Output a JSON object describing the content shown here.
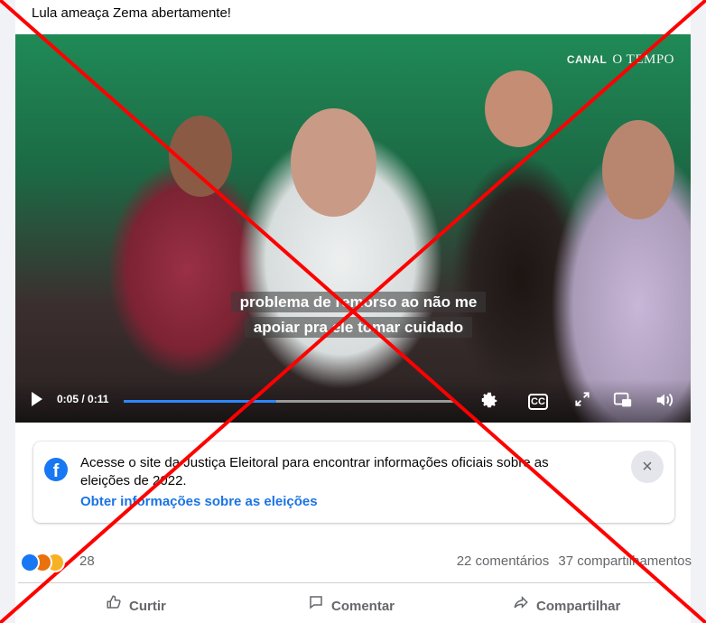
{
  "post": {
    "text": "Lula ameaça Zema abertamente!"
  },
  "video": {
    "watermark_prefix": "CANAL",
    "watermark_name": "O TEMPO",
    "subtitle_line1": "problema de remorso ao não me",
    "subtitle_line2": "apoiar pra ele tomar cuidado",
    "time": "0:05 / 0:11",
    "progress": 0.46,
    "icons": {
      "play": "play-icon",
      "settings": "gear-icon",
      "captions": "captions-icon",
      "expand": "expand-icon",
      "pip": "picture-in-picture-icon",
      "volume": "volume-icon"
    },
    "cc_label": "CC"
  },
  "info_box": {
    "text": "Acesse o site da Justiça Eleitoral para encontrar informações oficiais sobre as eleições de 2022.",
    "link": "Obter informações sobre as eleições",
    "close": "×",
    "logo": "f"
  },
  "reactions": {
    "count": "28",
    "types": [
      "like",
      "angry",
      "care"
    ]
  },
  "stats": {
    "comments": "22 comentários",
    "shares": "37 compartilhamentos"
  },
  "actions": {
    "like": "Curtir",
    "comment": "Comentar",
    "share": "Compartilhar"
  },
  "overlay": {
    "color": "#ff0000"
  },
  "colors": {
    "accent": "#1877f2",
    "link": "#1b74e4",
    "progress": "#2d88ff"
  }
}
